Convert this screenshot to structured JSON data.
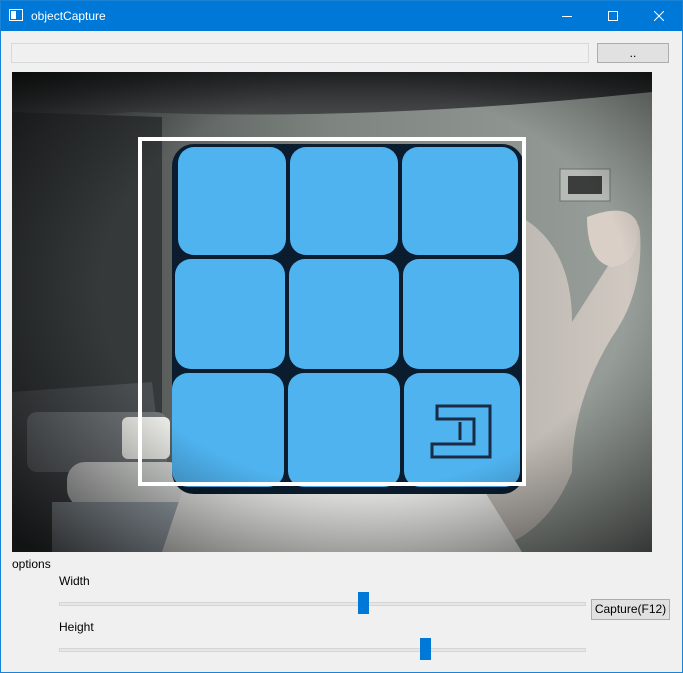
{
  "window": {
    "title": "objectCapture",
    "controls": {
      "minimize": "minimize-icon",
      "maximize": "maximize-icon",
      "close": "close-icon"
    }
  },
  "toolbar": {
    "path_value": "",
    "browse_label": ".."
  },
  "preview": {
    "selection_box_color": "#ffffff",
    "object_color": "#4fb3ef"
  },
  "options": {
    "label": "options",
    "width": {
      "label": "Width",
      "value_fraction": 0.58
    },
    "height": {
      "label": "Height",
      "value_fraction": 0.7
    },
    "capture_label": "Capture(F12)"
  },
  "colors": {
    "titlebar": "#0078d7",
    "accent": "#0078d7",
    "window_bg": "#f0f0f0"
  }
}
